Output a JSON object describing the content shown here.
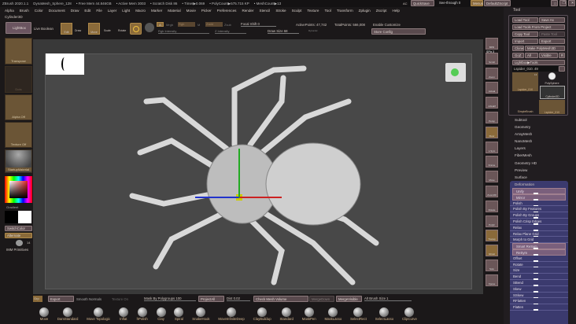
{
  "titlebar": {
    "app": "ZBrush 2020.1.1",
    "doc": "DynaMesh_Sphere_128",
    "free_mem": "• Free Mem 44.846GB",
    "active_mem": "• Active Mem 3003",
    "scratch": "• Scratch Disk 86",
    "timer": "• Timer▶0.069",
    "polycount": "• PolyCount▶575.715 KP",
    "meshcount": "• MeshCount▶13",
    "ac": "AC",
    "quicksave": "QuickSave",
    "seethrough": "See-through 0",
    "menus": "Menus",
    "defaultzscript": "DefaultZScript"
  },
  "menu": [
    "Alpha",
    "Brush",
    "Color",
    "Document",
    "Draw",
    "Edit",
    "File",
    "Layer",
    "Light",
    "Macro",
    "Marker",
    "Material",
    "Movie",
    "Picker",
    "Preferences",
    "Render",
    "Stencil",
    "Stroke",
    "Sculpt",
    "Texture",
    "Tool",
    "Transform",
    "Zplugin",
    "Zscript",
    "Help"
  ],
  "current_tool": "Cylinder3D",
  "toolbar": {
    "lightbox": "LightBox",
    "live_boolean": "Live Boolean",
    "edit": "Edit",
    "draw": "Draw",
    "move": "Move",
    "scale": "Scale",
    "rotate": "Rotate",
    "a": "A",
    "mrgb": "Mrgb",
    "rgb": "Rgb",
    "m": "M",
    "zadd": "Zadd",
    "zsub": "Zsub",
    "rgb_intensity": "Rgb Intensity",
    "z_intensity": "Z Intensity",
    "focal_shift": "Focal Shift 0",
    "draw_size": "Draw Size 68",
    "dynamic": "Dynamic",
    "active_points": "ActivePoints: 47,742",
    "total_points": "TotalPoints: 566,008",
    "enable_customize": "Enable Customize",
    "store_config": "Store Config"
  },
  "left": {
    "transpose": "Transpose",
    "dots": "Dots",
    "alpha_off": "Alpha Off",
    "texture_off": "Texture Off",
    "material": "StartupMaterial",
    "gradient": "Gradient",
    "switchcolor": "SwitchColor",
    "alternate": "Alternate",
    "imm_count": "14",
    "imm": "IMM Primitives"
  },
  "shelf": [
    "BPR",
    "Scroll",
    "Zoom",
    "Actual",
    "AAHalf",
    "Persp",
    "Floor",
    "L.Sym",
    "Frame",
    "Move",
    "Zoom3D",
    "Rotate",
    "PolyF",
    "Transp",
    "Ghost",
    "Solo",
    "Xpose"
  ],
  "shelf_spix": "SPix 3",
  "tool_panel": {
    "title": "Tool",
    "load_tool": "Load Tool",
    "save_as": "Save As",
    "load_from_project": "Load Tools From Project",
    "copy_tool": "Copy Tool",
    "paste_tool": "Paste Tool",
    "import": "Import",
    "export": "Export",
    "clone": "Clone",
    "make_polymesh": "Make PolyMesh3D",
    "goz": "GoZ",
    "all": "All",
    "visible": "Visible",
    "r": "R",
    "lightbox_tools": "Lightbox▶Tools",
    "tool_name": "Lspider_010. 49",
    "thumb1": "Lspider_010",
    "thumb2": "PolySphere",
    "thumb3": "Cylinder3D",
    "thumb4": "SimpleBrush",
    "thumb5": "Lspider_010",
    "thumb_count": "13",
    "sections": [
      "Subtool",
      "Geometry",
      "ArrayMesh",
      "NanoMesh",
      "Layers",
      "FiberMesh",
      "Geometry HD",
      "Preview",
      "Surface"
    ],
    "deformation": "Deformation",
    "deform_items": [
      "Unify",
      "Mirror",
      "Polish",
      "Polish By Features",
      "Polish By Groups",
      "Polish Crisp Edges",
      "Relax",
      "Relax Plane Grid",
      "Morph to Grid",
      "Smart ReSym",
      "ReSym",
      "Offset",
      "Rotate",
      "Size",
      "Bend",
      "SBend",
      "Skew",
      "SSkew",
      "RFlatten",
      "Flatten"
    ]
  },
  "bottom": {
    "grp": "Grp",
    "export": "Export",
    "smooth_normals": "Smooth Normals",
    "texture_on": "Texture On",
    "mask_by_polygroups": "Mask By Polygroups 100",
    "projectall": "ProjectAll",
    "dist": "Dist 0.02",
    "check_mesh": "Check Mesh Volume",
    "mergedown": "MergeDown",
    "mergevisible": "MergeVisible",
    "alt_brush": "Alt Brush Size 1"
  },
  "brushes": [
    "Move",
    "DamStandard",
    "Move Topologic",
    "Inflat",
    "hPolish",
    "Clay",
    "Spiral",
    "SnakeHook",
    "MoveInfiniteDeep",
    "ClayBuildup",
    "Standard",
    "MaskPen",
    "MaskLasso",
    "SelectRect",
    "SelectLasso",
    "ClipCurve"
  ],
  "colors": {
    "accent": "#8a6a3a",
    "panel": "#3b3a6e",
    "bg": "#1b1819"
  }
}
